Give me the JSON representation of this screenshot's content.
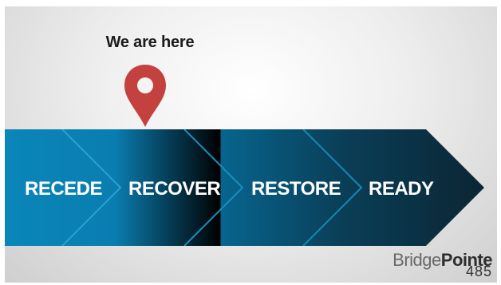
{
  "pointer": {
    "label": "We are here",
    "icon": "map-pin-icon",
    "color": "#c3413f",
    "current_step": "RECOVER"
  },
  "steps": [
    {
      "label": "RECEDE",
      "color": "#0a86b8"
    },
    {
      "label": "RECOVER",
      "color": "#0770a0"
    },
    {
      "label": "RESTORE",
      "color": "#0a4764"
    },
    {
      "label": "READY",
      "color": "#0b2937"
    }
  ],
  "brand": {
    "name_light": "Bridge",
    "name_bold": "Pointe",
    "number": "485"
  }
}
